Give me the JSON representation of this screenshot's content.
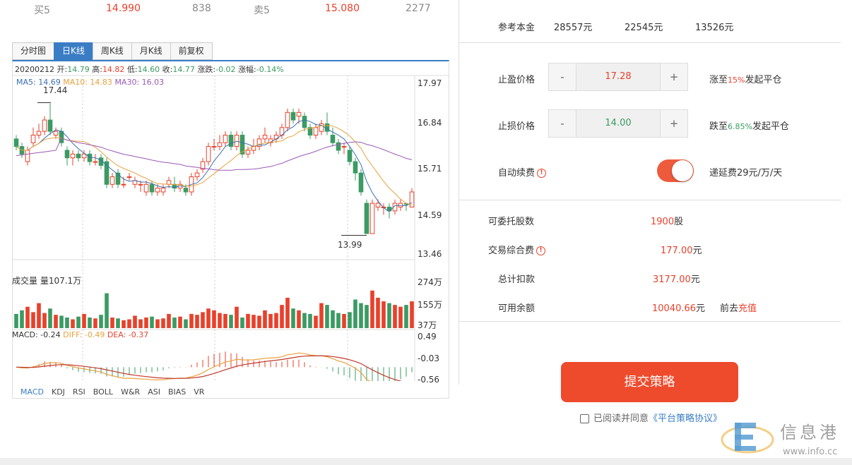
{
  "quote": {
    "buy_label": "买5",
    "buy_price": "14.990",
    "buy_vol": "838",
    "sell_label": "卖5",
    "sell_price": "15.080",
    "sell_vol": "2277"
  },
  "chart_tabs": [
    "分时图",
    "日K线",
    "周K线",
    "月K线",
    "前复权"
  ],
  "info": {
    "date": "20200212",
    "open_label": "开:",
    "open": "14.79",
    "high_label": "高:",
    "high": "14.82",
    "low_label": "低:",
    "low": "14.60",
    "close_label": "收:",
    "close": "14.77",
    "chg_label": "涨跌:",
    "chg": "-0.02",
    "pct_label": "涨幅:",
    "pct": "-0.14%"
  },
  "ma": {
    "ma5": "MA5: 14.69",
    "ma10": "MA10: 14.83",
    "ma30": "MA30: 16.03"
  },
  "price_axis": [
    "17.97",
    "16.84",
    "15.71",
    "14.59",
    "13.46"
  ],
  "hi_mark": "17.44",
  "lo_mark": "13.99",
  "vol_title": "成交量 量107.1万",
  "vol_axis": [
    "274万",
    "155万",
    "37万"
  ],
  "macd_title": {
    "macd": "MACD: -0.24",
    "diff": "DIFF: -0.49",
    "dea": "DEA: -0.37"
  },
  "macd_axis": [
    "0.49",
    "-0.03",
    "-0.56"
  ],
  "indicator_tabs": [
    "MACD",
    "KDJ",
    "RSI",
    "BOLL",
    "W&R",
    "ASI",
    "BIAS",
    "VR"
  ],
  "capital": {
    "label": "参考本金",
    "options": [
      "28557元",
      "22545元",
      "13526元"
    ]
  },
  "take_profit": {
    "label": "止盈价格",
    "minus": "-",
    "value": "17.28",
    "plus": "+",
    "note_prefix": "涨至",
    "note_pct": "15%",
    "note_suffix": "发起平仓"
  },
  "stop_loss": {
    "label": "止损价格",
    "minus": "-",
    "value": "14.00",
    "plus": "+",
    "note_prefix": "跌至",
    "note_pct": "6.85%",
    "note_suffix": "发起平仓"
  },
  "auto_renew": {
    "label": "自动续费",
    "warn": "!",
    "note": "递延费29元/万/天"
  },
  "shares": {
    "label": "可委托股数",
    "value": "1900",
    "unit": "股"
  },
  "fee": {
    "label": "交易综合费",
    "warn": "!",
    "value": "177.00",
    "unit": "元"
  },
  "total": {
    "label": "总计扣款",
    "value": "3177.00",
    "unit": "元"
  },
  "balance": {
    "label": "可用余额",
    "value": "10040.66",
    "unit": "元",
    "goto": "前去",
    "recharge": "充值"
  },
  "submit_label": "提交策略",
  "agree": {
    "text": "已阅读并同意",
    "link": "《平台策略协议》"
  },
  "watermark": {
    "text": "信息港",
    "url": "www.info.cc"
  },
  "colors": {
    "up": "#e8412b",
    "down": "#3a9b63",
    "accent": "#3a7dc4",
    "button": "#ee4a2c"
  },
  "chart_data": {
    "type": "candlestick",
    "price_range": [
      13.46,
      17.97
    ],
    "candles": [
      [
        16.5,
        16.3,
        16.6,
        16.2
      ],
      [
        16.3,
        16.1,
        16.4,
        16.0
      ],
      [
        15.9,
        16.2,
        16.3,
        15.8
      ],
      [
        16.4,
        16.6,
        16.8,
        16.3
      ],
      [
        16.6,
        16.7,
        16.9,
        16.5
      ],
      [
        16.7,
        17.0,
        17.1,
        16.6
      ],
      [
        17.0,
        16.7,
        17.44,
        16.6
      ],
      [
        16.6,
        16.7,
        16.8,
        16.5
      ],
      [
        16.7,
        16.4,
        16.8,
        16.3
      ],
      [
        16.2,
        16.0,
        16.3,
        15.8
      ],
      [
        16.0,
        16.1,
        16.2,
        15.8
      ],
      [
        16.1,
        16.0,
        16.2,
        15.9
      ],
      [
        16.0,
        16.1,
        16.2,
        15.9
      ],
      [
        16.1,
        15.9,
        16.2,
        15.8
      ],
      [
        15.9,
        15.9,
        16.1,
        15.8
      ],
      [
        16.0,
        15.8,
        16.1,
        15.7
      ],
      [
        15.9,
        15.3,
        16.0,
        15.2
      ],
      [
        15.3,
        15.5,
        15.6,
        15.2
      ],
      [
        15.6,
        15.3,
        15.7,
        15.2
      ],
      [
        15.3,
        15.3,
        15.5,
        15.2
      ],
      [
        15.5,
        15.5,
        15.6,
        15.4
      ],
      [
        15.3,
        15.4,
        15.5,
        15.2
      ],
      [
        15.3,
        15.3,
        15.4,
        15.1
      ],
      [
        15.1,
        15.3,
        15.4,
        15.0
      ],
      [
        15.3,
        15.1,
        15.4,
        15.0
      ],
      [
        15.1,
        15.2,
        15.3,
        15.0
      ],
      [
        15.1,
        15.2,
        15.3,
        15.0
      ],
      [
        15.3,
        15.4,
        15.5,
        15.2
      ],
      [
        15.3,
        15.2,
        15.5,
        15.1
      ],
      [
        15.2,
        15.3,
        15.4,
        15.1
      ],
      [
        15.2,
        15.1,
        15.3,
        15.0
      ],
      [
        15.1,
        15.5,
        15.6,
        15.0
      ],
      [
        15.5,
        15.6,
        15.7,
        15.4
      ],
      [
        15.7,
        15.9,
        16.0,
        15.6
      ],
      [
        15.9,
        16.3,
        16.4,
        15.8
      ],
      [
        16.3,
        16.3,
        16.5,
        16.2
      ],
      [
        16.3,
        16.4,
        16.6,
        16.2
      ],
      [
        16.4,
        16.6,
        16.7,
        16.3
      ],
      [
        16.6,
        16.3,
        16.7,
        16.2
      ],
      [
        16.3,
        16.6,
        16.7,
        16.2
      ],
      [
        16.6,
        16.1,
        16.7,
        16.0
      ],
      [
        16.1,
        16.2,
        16.3,
        16.0
      ],
      [
        16.2,
        16.3,
        16.5,
        16.1
      ],
      [
        16.3,
        16.5,
        16.6,
        16.2
      ],
      [
        16.5,
        16.6,
        16.8,
        16.4
      ],
      [
        16.4,
        16.5,
        16.6,
        16.3
      ],
      [
        16.5,
        16.6,
        16.7,
        16.4
      ],
      [
        16.6,
        16.8,
        16.9,
        16.5
      ],
      [
        16.8,
        17.2,
        17.3,
        16.7
      ],
      [
        17.2,
        17.0,
        17.3,
        16.9
      ],
      [
        17.1,
        17.2,
        17.3,
        16.9
      ],
      [
        17.1,
        16.8,
        17.2,
        16.7
      ],
      [
        16.8,
        16.6,
        16.9,
        16.5
      ],
      [
        16.6,
        16.8,
        16.9,
        16.5
      ],
      [
        16.7,
        16.9,
        17.0,
        16.6
      ],
      [
        16.9,
        16.7,
        17.2,
        16.6
      ],
      [
        16.6,
        16.4,
        16.8,
        16.3
      ],
      [
        16.4,
        16.2,
        16.5,
        16.1
      ],
      [
        16.3,
        16.3,
        16.4,
        16.1
      ],
      [
        16.2,
        15.9,
        16.3,
        15.8
      ],
      [
        15.9,
        15.6,
        16.0,
        15.4
      ],
      [
        15.6,
        15.1,
        15.7,
        15.0
      ],
      [
        14.8,
        14.0,
        14.9,
        13.99
      ],
      [
        14.0,
        14.8,
        14.9,
        13.99
      ],
      [
        14.7,
        14.8,
        14.9,
        14.6
      ],
      [
        14.7,
        14.7,
        14.8,
        14.5
      ],
      [
        14.7,
        14.6,
        14.8,
        14.4
      ],
      [
        14.6,
        14.8,
        14.9,
        14.5
      ],
      [
        14.7,
        14.8,
        14.9,
        14.6
      ],
      [
        14.79,
        14.77,
        14.82,
        14.6
      ],
      [
        14.7,
        15.1,
        15.2,
        14.7
      ]
    ],
    "volume_range": [
      37,
      274
    ],
    "volumes": [
      90,
      110,
      130,
      100,
      150,
      95,
      120,
      85,
      80,
      70,
      60,
      75,
      90,
      70,
      65,
      85,
      205,
      70,
      65,
      55,
      60,
      80,
      60,
      70,
      75,
      60,
      65,
      90,
      70,
      75,
      60,
      90,
      85,
      100,
      120,
      110,
      95,
      90,
      85,
      130,
      70,
      90,
      85,
      80,
      110,
      90,
      95,
      140,
      180,
      120,
      110,
      95,
      90,
      80,
      150,
      140,
      110,
      95,
      90,
      100,
      170,
      150,
      140,
      220,
      180,
      160,
      150,
      140,
      130,
      140,
      160
    ],
    "macd_range": [
      -0.56,
      0.49
    ]
  }
}
